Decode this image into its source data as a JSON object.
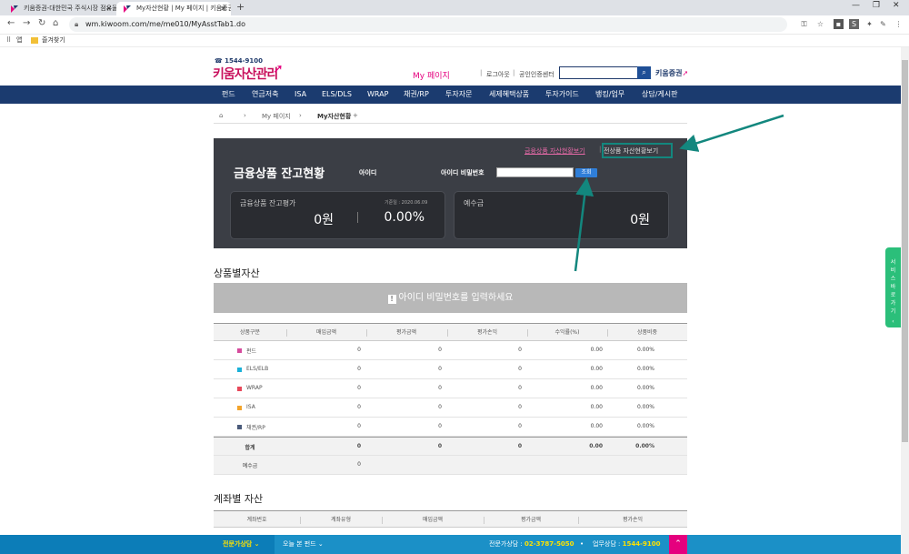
{
  "browser": {
    "tabs": [
      {
        "title": "키움증권-대한민국 주식시장 점유율 1위",
        "active": false
      },
      {
        "title": "My자산현황 | My 페이지 | 키움증권",
        "active": true
      }
    ],
    "url": "wm.kiwoom.com/me/me010/MyAsstTab1.do",
    "bookmarks": [
      "앱",
      "즐겨찾기"
    ]
  },
  "header": {
    "phone": "☎ 1544-9100",
    "logo": "키움자산관리",
    "page_title": "My 페이지",
    "util_links": [
      "로그아웃",
      "공인인증센터"
    ],
    "brand": "키움증권"
  },
  "gnb": [
    "펀드",
    "연금저축",
    "ISA",
    "ELS/DLS",
    "WRAP",
    "채권/RP",
    "투자자문",
    "세제혜택상품",
    "투자가이드",
    "뱅킹/업무",
    "상담/게시판"
  ],
  "breadcrumb": [
    "My 페이지",
    "My자산현황"
  ],
  "summary": {
    "link1": "금융상품 자산현황보기",
    "link2": "전상품 자산현황보기",
    "title": "금융상품 잔고현황",
    "id_label": "아이디",
    "pw_label": "아이디 비밀번호",
    "pw_button": "조회",
    "card1": {
      "label": "금융상품 잔고평가",
      "date": "기준일 : 2020.06.09",
      "amount": "0원",
      "rate": "0.00%"
    },
    "card2": {
      "label": "예수금",
      "amount": "0원"
    }
  },
  "product_section": {
    "title": "상품별자산",
    "notice": "아이디 비밀번호를 입력하세요",
    "columns": [
      "상품구분",
      "매입금액",
      "평가금액",
      "평가손익",
      "수익률(%)",
      "상품비중"
    ],
    "rows": [
      {
        "name": "펀드",
        "color": "#d64b9d",
        "buy": "0",
        "eval": "0",
        "pl": "0",
        "rate": "0.00",
        "weight": "0.00%"
      },
      {
        "name": "ELS/ELB",
        "color": "#1bb1d8",
        "buy": "0",
        "eval": "0",
        "pl": "0",
        "rate": "0.00",
        "weight": "0.00%"
      },
      {
        "name": "WRAP",
        "color": "#e8485a",
        "buy": "0",
        "eval": "0",
        "pl": "0",
        "rate": "0.00",
        "weight": "0.00%"
      },
      {
        "name": "ISA",
        "color": "#f3a42b",
        "buy": "0",
        "eval": "0",
        "pl": "0",
        "rate": "0.00",
        "weight": "0.00%"
      },
      {
        "name": "채권/RP",
        "color": "#4a5a7a",
        "buy": "0",
        "eval": "0",
        "pl": "0",
        "rate": "0.00",
        "weight": "0.00%"
      }
    ],
    "total": {
      "label": "합계",
      "buy": "0",
      "eval": "0",
      "pl": "0",
      "rate": "0.00",
      "weight": "0.00%"
    },
    "deposit": {
      "label": "예수금",
      "value": "0"
    }
  },
  "account_section": {
    "title": "계좌별 자산",
    "columns": [
      "계좌번호",
      "계좌유형",
      "매입금액",
      "평가금액",
      "평가손익"
    ]
  },
  "footer": {
    "consult": "전문가상담",
    "today_fund": "오늘 본 펀드",
    "expert_phone_label": "전문가상담 :",
    "expert_phone": "02-3787-5050",
    "biz_phone_label": "업무상담 :",
    "biz_phone": "1544-9100"
  },
  "side_tab": "서비스 바로가기",
  "annotation_color": "#13877e"
}
